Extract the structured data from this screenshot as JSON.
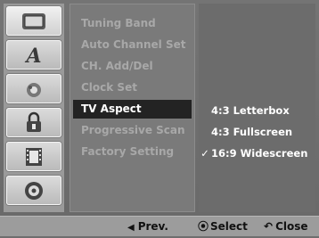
{
  "sidebar": {
    "icons": [
      {
        "name": "tv-screen-icon",
        "active": true
      },
      {
        "name": "language-letter-icon",
        "active": false
      },
      {
        "name": "audio-speaker-icon",
        "active": false
      },
      {
        "name": "lock-icon",
        "active": false
      },
      {
        "name": "film-strip-icon",
        "active": false
      },
      {
        "name": "disc-icon",
        "active": false
      }
    ]
  },
  "menu": {
    "items": [
      {
        "label": "Tuning Band"
      },
      {
        "label": "Auto Channel Set"
      },
      {
        "label": "CH. Add/Del"
      },
      {
        "label": "Clock Set"
      },
      {
        "label": "TV Aspect"
      },
      {
        "label": "Progressive Scan"
      },
      {
        "label": "Factory Setting"
      }
    ],
    "selected_label": "TV Aspect"
  },
  "options": {
    "items": [
      {
        "label": "4:3 Letterbox"
      },
      {
        "label": "4:3 Fullscreen"
      },
      {
        "label": "16:9 Widescreen"
      }
    ],
    "checked_label": "16:9 Widescreen",
    "check_mark": "✓"
  },
  "footer": {
    "prev_label": "Prev.",
    "prev_glyph": "◀",
    "select_label": "Select",
    "select_glyph": "⦿",
    "close_label": "Close",
    "close_glyph": "↶"
  },
  "colors": {
    "selected_bg": "#232323",
    "inactive_text": "#a8a8a8",
    "active_text": "#ffffff"
  }
}
